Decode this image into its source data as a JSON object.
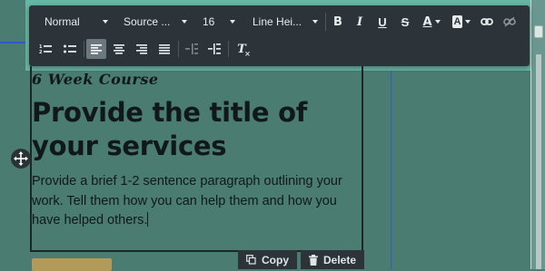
{
  "toolbar": {
    "paragraph_style": "Normal",
    "font_family": "Source ...",
    "font_size": "16",
    "line_height": "Line Hei...",
    "buttons": {
      "bold": "B",
      "italic": "I",
      "underline": "U",
      "strike": "S",
      "text_color": "A",
      "highlight": "A",
      "clear_format": "T"
    },
    "icons": [
      "bold-icon",
      "italic-icon",
      "underline-icon",
      "strikethrough-icon",
      "text-color-icon",
      "background-color-icon",
      "link-icon",
      "unlink-icon",
      "ordered-list-icon",
      "bullet-list-icon",
      "align-left-icon",
      "align-center-icon",
      "align-right-icon",
      "align-justify-icon",
      "outdent-icon",
      "indent-icon",
      "clear-formatting-icon"
    ]
  },
  "module": {
    "eyebrow": "6 Week Course",
    "headline": "Provide the title of your services",
    "body": "Provide a brief 1-2 sentence paragraph outlining your work. Tell them how you can help them and how you have helped others."
  },
  "actions": {
    "copy": "Copy",
    "delete": "Delete"
  },
  "colors": {
    "canvas": "#4a7c72",
    "toolbar": "#2c3439",
    "accent_strip": "#67b5a4",
    "button_gold": "#b19a5a",
    "guide_blue": "#2f59c9"
  }
}
